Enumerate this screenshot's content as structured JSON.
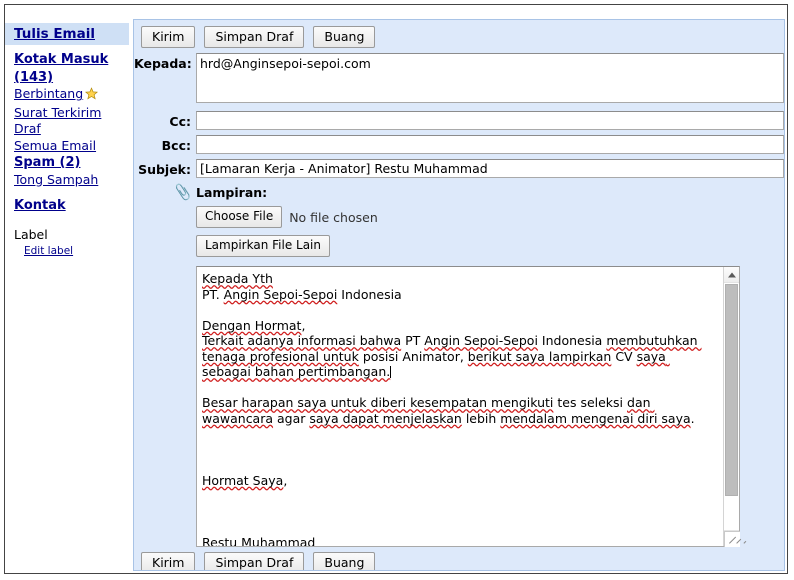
{
  "sidebar": {
    "compose_label": "Tulis Email",
    "items": [
      {
        "label": "Kotak Masuk (143)",
        "bold": true,
        "icon": null
      },
      {
        "label": "Berbintang",
        "bold": false,
        "icon": "star-icon"
      },
      {
        "label": "Surat Terkirim",
        "bold": false,
        "icon": null
      },
      {
        "label": "Draf",
        "bold": false,
        "icon": null
      },
      {
        "label": "Semua Email",
        "bold": false,
        "icon": null
      },
      {
        "label": "Spam (2)",
        "bold": true,
        "icon": null
      },
      {
        "label": "Tong Sampah",
        "bold": false,
        "icon": null
      }
    ],
    "contacts_label": "Kontak",
    "label_title": "Label",
    "edit_label": "Edit label"
  },
  "toolbar": {
    "send_label": "Kirim",
    "save_draft_label": "Simpan Draf",
    "discard_label": "Buang"
  },
  "form": {
    "to_label": "Kepada:",
    "to_value": "hrd@Anginsepoi-sepoi.com",
    "cc_label": "Cc:",
    "cc_value": "",
    "bcc_label": "Bcc:",
    "bcc_value": "",
    "subject_label": "Subjek:",
    "subject_value": "[Lamaran Kerja - Animator] Restu Muhammad"
  },
  "attachment": {
    "title": "Lampiran:",
    "choose_file_label": "Choose File",
    "no_file_text": "No file chosen",
    "attach_more_label": "Lampirkan File Lain",
    "clip_icon": "paperclip-icon"
  },
  "body": {
    "line1": "Kepada Yth",
    "line2_a": "PT. ",
    "line2_b": "Angin Sepoi-Sepoi",
    "line2_c": " Indonesia",
    "greeting_a": "Dengan Hormat",
    "greeting_b": ",",
    "para1_a": "Terkait adanya informasi bahwa",
    "para1_b": " PT ",
    "para1_c": "Angin Sepoi-Sepoi",
    "para1_d": " Indonesia ",
    "para1_e": "membutuhkan tenaga profesional untuk",
    "para1_f": " posisi Animator, ",
    "para1_g": "berikut saya lampirkan",
    "para1_h": " CV ",
    "para1_i": "saya sebagai bahan pertimbangan.",
    "para2_a": "Besar harapan saya untuk diberi kesempatan mengikuti",
    "para2_b": " tes seleksi ",
    "para2_c": "dan wawancara",
    "para2_d": " agar ",
    "para2_e": "saya dapat menjelaskan",
    "para2_f": " lebih ",
    "para2_g": "mendalam mengenai diri saya",
    "para2_h": ".",
    "closing_a": "Hormat Saya",
    "closing_b": ",",
    "signature_a": "Restu",
    "signature_b": " Muhammad"
  },
  "scrollbar": {
    "up_arrow": "scroll-up-arrow-icon",
    "down_arrow": "scroll-down-arrow-icon"
  },
  "colors": {
    "panel_bg": "#dde9fa",
    "link": "#00008b",
    "compose_highlight": "#cfe0f5",
    "spellcheck": "#d02020",
    "star": "#ffd24d"
  }
}
